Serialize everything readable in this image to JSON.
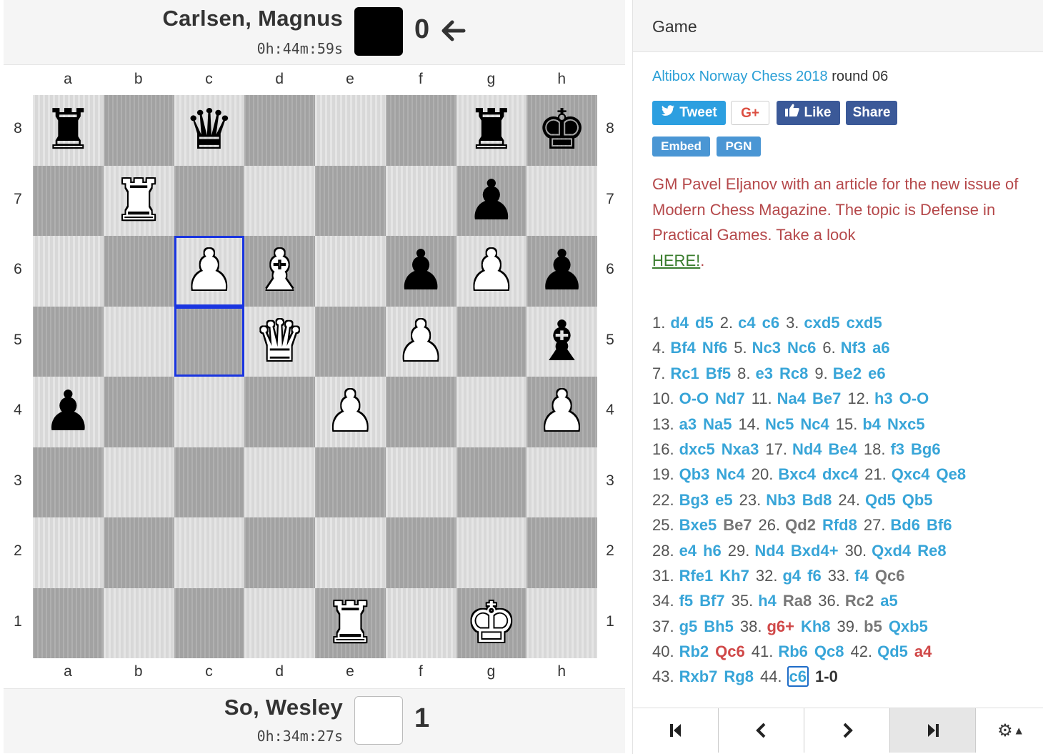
{
  "top_player": {
    "name": "Carlsen, Magnus",
    "clock": "0h:44m:59s",
    "score": "0",
    "color": "#000000"
  },
  "bottom_player": {
    "name": "So, Wesley",
    "clock": "0h:34m:27s",
    "score": "1",
    "color": "#ffffff"
  },
  "board": {
    "files": [
      "a",
      "b",
      "c",
      "d",
      "e",
      "f",
      "g",
      "h"
    ],
    "ranks": [
      "8",
      "7",
      "6",
      "5",
      "4",
      "3",
      "2",
      "1"
    ],
    "pieces": [
      {
        "sq": "a8",
        "glyph": "♜",
        "side": "b"
      },
      {
        "sq": "c8",
        "glyph": "♛",
        "side": "b"
      },
      {
        "sq": "g8",
        "glyph": "♜",
        "side": "b"
      },
      {
        "sq": "h8",
        "glyph": "♚",
        "side": "b"
      },
      {
        "sq": "b7",
        "glyph": "♜",
        "side": "w"
      },
      {
        "sq": "g7",
        "glyph": "♟",
        "side": "b"
      },
      {
        "sq": "c6",
        "glyph": "♟",
        "side": "w"
      },
      {
        "sq": "d6",
        "glyph": "♝",
        "side": "w"
      },
      {
        "sq": "f6",
        "glyph": "♟",
        "side": "b"
      },
      {
        "sq": "g6",
        "glyph": "♟",
        "side": "w"
      },
      {
        "sq": "h6",
        "glyph": "♟",
        "side": "b"
      },
      {
        "sq": "d5",
        "glyph": "♛",
        "side": "w"
      },
      {
        "sq": "f5",
        "glyph": "♟",
        "side": "w"
      },
      {
        "sq": "h5",
        "glyph": "♝",
        "side": "b"
      },
      {
        "sq": "a4",
        "glyph": "♟",
        "side": "b"
      },
      {
        "sq": "e4",
        "glyph": "♟",
        "side": "w"
      },
      {
        "sq": "h4",
        "glyph": "♟",
        "side": "w"
      },
      {
        "sq": "e1",
        "glyph": "♜",
        "side": "w"
      },
      {
        "sq": "g1",
        "glyph": "♚",
        "side": "w"
      }
    ],
    "highlight": [
      "c6",
      "c5"
    ],
    "highlight_color": "#1a35e0"
  },
  "panel": {
    "heading": "Game",
    "event_name": "Altibox Norway Chess 2018",
    "event_round": "round 06",
    "social": {
      "tweet": "Tweet",
      "gplus": "G+",
      "like": "Like",
      "share": "Share"
    },
    "tags": {
      "embed": "Embed",
      "pgn": "PGN"
    },
    "comment": "GM Pavel Eljanov with an article for the new issue of Modern Chess Magazine. The topic is Defense in Practical Games. Take a look",
    "comment_link": "HERE!",
    "comment_tail": ".",
    "result": "1-0"
  },
  "moves": [
    [
      {
        "n": "1."
      },
      {
        "m": "d4"
      },
      {
        "m": "d5"
      },
      {
        "n": "2."
      },
      {
        "m": "c4"
      },
      {
        "m": "c6"
      },
      {
        "n": "3."
      },
      {
        "m": "cxd5"
      },
      {
        "m": "cxd5"
      }
    ],
    [
      {
        "n": "4."
      },
      {
        "m": "Bf4"
      },
      {
        "m": "Nf6"
      },
      {
        "n": "5."
      },
      {
        "m": "Nc3"
      },
      {
        "m": "Nc6"
      },
      {
        "n": "6."
      },
      {
        "m": "Nf3"
      },
      {
        "m": "a6"
      }
    ],
    [
      {
        "n": "7."
      },
      {
        "m": "Rc1"
      },
      {
        "m": "Bf5"
      },
      {
        "n": "8."
      },
      {
        "m": "e3"
      },
      {
        "m": "Rc8"
      },
      {
        "n": "9."
      },
      {
        "m": "Be2"
      },
      {
        "m": "e6"
      }
    ],
    [
      {
        "n": "10."
      },
      {
        "m": "O-O"
      },
      {
        "m": "Nd7"
      },
      {
        "n": "11."
      },
      {
        "m": "Na4"
      },
      {
        "m": "Be7"
      },
      {
        "n": "12."
      },
      {
        "m": "h3"
      },
      {
        "m": "O-O"
      }
    ],
    [
      {
        "n": "13."
      },
      {
        "m": "a3"
      },
      {
        "m": "Na5"
      },
      {
        "n": "14."
      },
      {
        "m": "Nc5"
      },
      {
        "m": "Nc4"
      },
      {
        "n": "15."
      },
      {
        "m": "b4"
      },
      {
        "m": "Nxc5"
      }
    ],
    [
      {
        "n": "16."
      },
      {
        "m": "dxc5"
      },
      {
        "m": "Nxa3"
      },
      {
        "n": "17."
      },
      {
        "m": "Nd4"
      },
      {
        "m": "Be4"
      },
      {
        "n": "18."
      },
      {
        "m": "f3"
      },
      {
        "m": "Bg6"
      }
    ],
    [
      {
        "n": "19."
      },
      {
        "m": "Qb3"
      },
      {
        "m": "Nc4"
      },
      {
        "n": "20."
      },
      {
        "m": "Bxc4"
      },
      {
        "m": "dxc4"
      },
      {
        "n": "21."
      },
      {
        "m": "Qxc4"
      },
      {
        "m": "Qe8"
      }
    ],
    [
      {
        "n": "22."
      },
      {
        "m": "Bg3"
      },
      {
        "m": "e5"
      },
      {
        "n": "23."
      },
      {
        "m": "Nb3"
      },
      {
        "m": "Bd8"
      },
      {
        "n": "24."
      },
      {
        "m": "Qd5"
      },
      {
        "m": "Qb5"
      }
    ],
    [
      {
        "n": "25."
      },
      {
        "m": "Bxe5"
      },
      {
        "m": "Be7",
        "c": "gray"
      },
      {
        "n": "26."
      },
      {
        "m": "Qd2",
        "c": "gray"
      },
      {
        "m": "Rfd8"
      },
      {
        "n": "27."
      },
      {
        "m": "Bd6"
      },
      {
        "m": "Bf6"
      }
    ],
    [
      {
        "n": "28."
      },
      {
        "m": "e4"
      },
      {
        "m": "h6"
      },
      {
        "n": "29."
      },
      {
        "m": "Nd4"
      },
      {
        "m": "Bxd4+"
      },
      {
        "n": "30."
      },
      {
        "m": "Qxd4"
      },
      {
        "m": "Re8"
      }
    ],
    [
      {
        "n": "31."
      },
      {
        "m": "Rfe1"
      },
      {
        "m": "Kh7"
      },
      {
        "n": "32."
      },
      {
        "m": "g4"
      },
      {
        "m": "f6"
      },
      {
        "n": "33."
      },
      {
        "m": "f4"
      },
      {
        "m": "Qc6",
        "c": "gray"
      }
    ],
    [
      {
        "n": "34."
      },
      {
        "m": "f5"
      },
      {
        "m": "Bf7"
      },
      {
        "n": "35."
      },
      {
        "m": "h4"
      },
      {
        "m": "Ra8",
        "c": "gray"
      },
      {
        "n": "36."
      },
      {
        "m": "Rc2",
        "c": "gray"
      },
      {
        "m": "a5"
      }
    ],
    [
      {
        "n": "37."
      },
      {
        "m": "g5"
      },
      {
        "m": "Bh5"
      },
      {
        "n": "38."
      },
      {
        "m": "g6+",
        "c": "red"
      },
      {
        "m": "Kh8"
      },
      {
        "n": "39."
      },
      {
        "m": "b5",
        "c": "gray"
      },
      {
        "m": "Qxb5"
      }
    ],
    [
      {
        "n": "40."
      },
      {
        "m": "Rb2"
      },
      {
        "m": "Qc6",
        "c": "red"
      },
      {
        "n": "41."
      },
      {
        "m": "Rb6"
      },
      {
        "m": "Qc8"
      },
      {
        "n": "42."
      },
      {
        "m": "Qd5"
      },
      {
        "m": "a4",
        "c": "red"
      }
    ],
    [
      {
        "n": "43."
      },
      {
        "m": "Rxb7"
      },
      {
        "m": "Rg8"
      },
      {
        "n": "44."
      },
      {
        "m": "c6",
        "c": "cur"
      },
      {
        "r": "1-0"
      }
    ]
  ],
  "nav_icons": [
    "first-icon",
    "prev-icon",
    "next-icon",
    "last-icon",
    "gear-icon"
  ],
  "colors": {
    "link": "#2a9fd6",
    "twitter": "#2c9fe0",
    "facebook": "#3b5998",
    "comment": "#b5484a"
  }
}
